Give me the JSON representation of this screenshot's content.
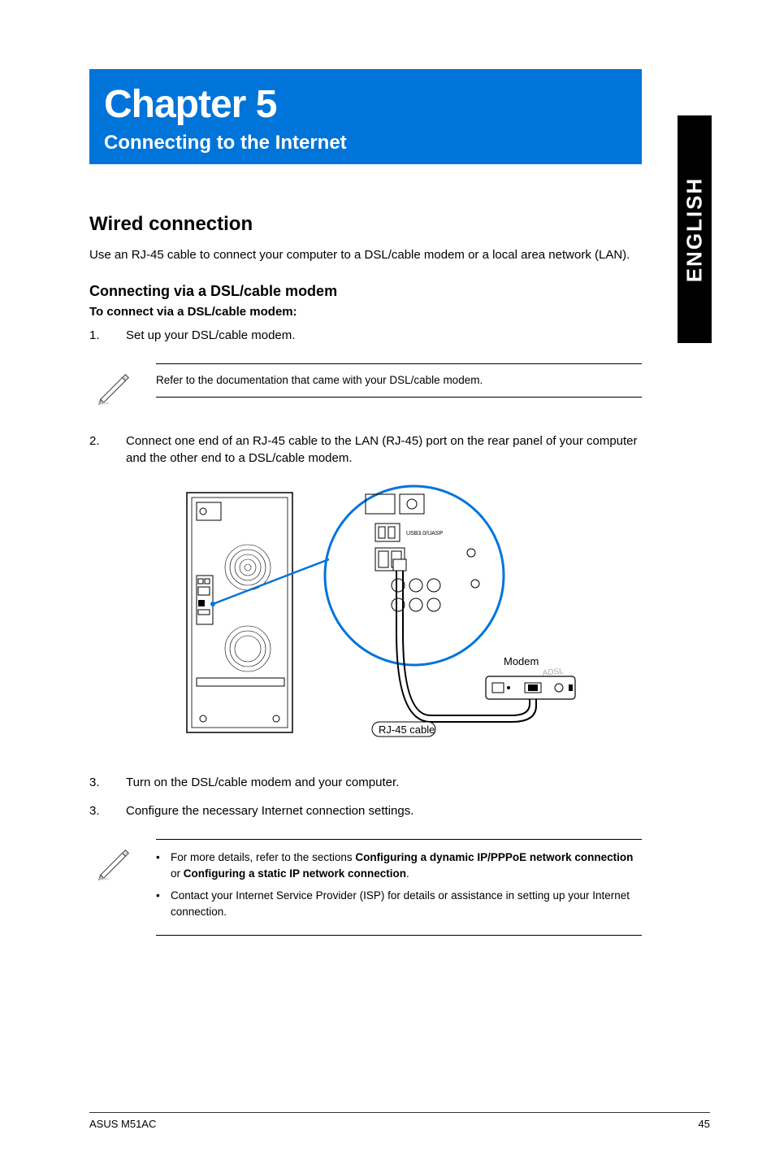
{
  "chapter": {
    "title": "Chapter 5",
    "subtitle": "Connecting to the Internet"
  },
  "side_tab": "ENGLISH",
  "section": {
    "heading": "Wired connection",
    "intro": "Use an RJ-45 cable to connect your computer to a DSL/cable modem or a local area network (LAN).",
    "subsection_heading": "Connecting via a DSL/cable modem",
    "procedure_lead": "To connect via a DSL/cable modem:",
    "steps": [
      {
        "num": "1.",
        "text": "Set up your DSL/cable modem."
      },
      {
        "num": "2.",
        "text": "Connect one end of an RJ-45 cable to the LAN (RJ-45) port on the rear panel of your computer and the other end to a DSL/cable modem."
      },
      {
        "num": "3.",
        "text": "Turn on the DSL/cable modem and your computer."
      },
      {
        "num": "3.",
        "text": "Configure the necessary Internet connection settings."
      }
    ]
  },
  "note1": {
    "text": "Refer to the documentation that came with your DSL/cable modem."
  },
  "note2": {
    "items": [
      {
        "pre": "For more details, refer to the sections ",
        "bold1": "Configuring a dynamic IP/PPPoE network connection",
        "mid": " or ",
        "bold2": "Configuring a static IP network connection",
        "post": "."
      },
      {
        "full": "Contact your Internet Service Provider (ISP) for details or assistance in setting up your Internet connection."
      }
    ]
  },
  "diagram": {
    "modem_label": "Modem",
    "cable_label": "RJ-45 cable",
    "modem_brand": "ADSL",
    "port_label_usb": "USB3.0/UASP"
  },
  "footer": {
    "left": "ASUS M51AC",
    "right": "45"
  }
}
